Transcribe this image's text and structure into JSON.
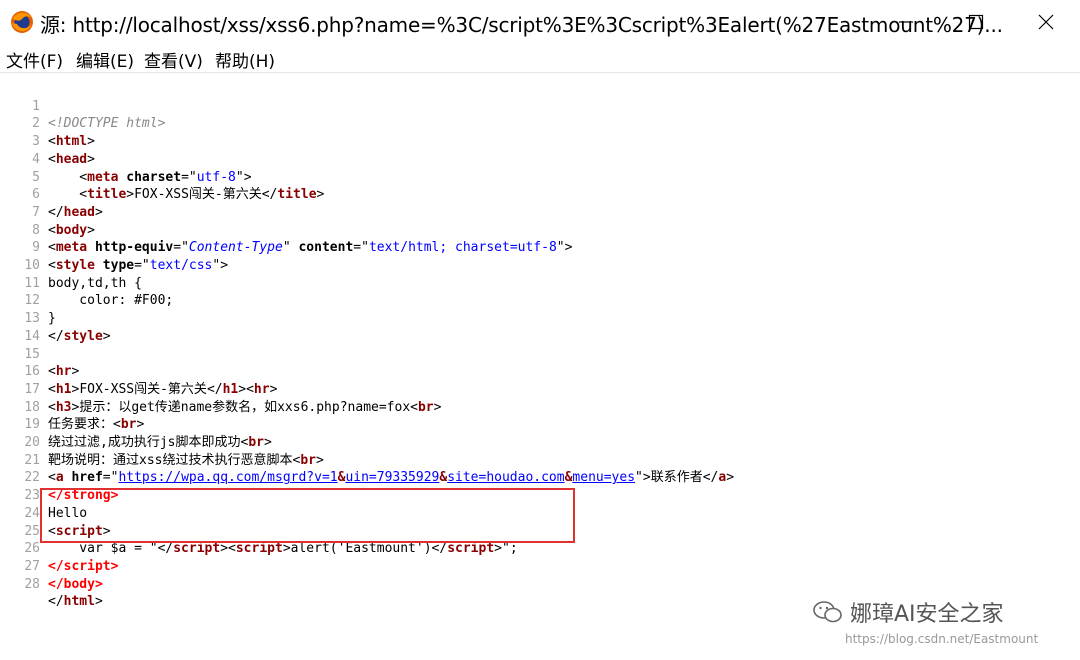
{
  "window": {
    "title": "源: http://localhost/xss/xss6.php?name=%3C/script%3E%3Cscript%3Ealert(%27Eastmount%27)..."
  },
  "menu": [
    {
      "label": "文件(F)"
    },
    {
      "label": "编辑(E)"
    },
    {
      "label": "查看(V)"
    },
    {
      "label": "帮助(H)"
    }
  ],
  "source_lines": [
    "1",
    "2",
    "3",
    "4",
    "5",
    "6",
    "7",
    "8",
    "9",
    "10",
    "11",
    "12",
    "13",
    "14",
    "15",
    "16",
    "17",
    "18",
    "19",
    "20",
    "21",
    "22",
    "23",
    "24",
    "25",
    "26",
    "27",
    "28"
  ],
  "source": {
    "doctype": "<!DOCTYPE html>",
    "title_text": "FOX-XSS闯关-第六关",
    "meta_charset": "utf-8",
    "meta_http_equiv": "Content-Type",
    "meta_content": "text/html; charset=utf-8",
    "style_type": "text/css",
    "css_selector": "body,td,th {",
    "css_rule": "    color: #F00;",
    "css_close": "}",
    "h1_text": "FOX-XSS闯关-第六关",
    "h3_text": "提示：以get传递name参数名，如xxs6.php?name=fox",
    "task_text": "任务要求：",
    "bypass_text": "绕过过滤,成功执行js脚本即成功",
    "range_text": "靶场说明：通过xss绕过技术执行恶意脚本",
    "link_href_1": "https://wpa.qq.com/msgrd?v=1",
    "link_href_2": "uin=79335929",
    "link_href_3": "site=houdao.com",
    "link_href_4": "menu=yes",
    "link_text": "联系作者",
    "hello": "Hello",
    "script_var": "    var $a = \"",
    "script_alert": "alert('Eastmount')",
    "script_end": "\";"
  },
  "watermark": {
    "brand": "娜璋AI安全之家",
    "url": "https://blog.csdn.net/Eastmount"
  },
  "colors": {
    "tag_name": "#880000",
    "attr_value": "#0000ff",
    "error_tag": "#ff0000",
    "highlight_box": "#e03030"
  }
}
